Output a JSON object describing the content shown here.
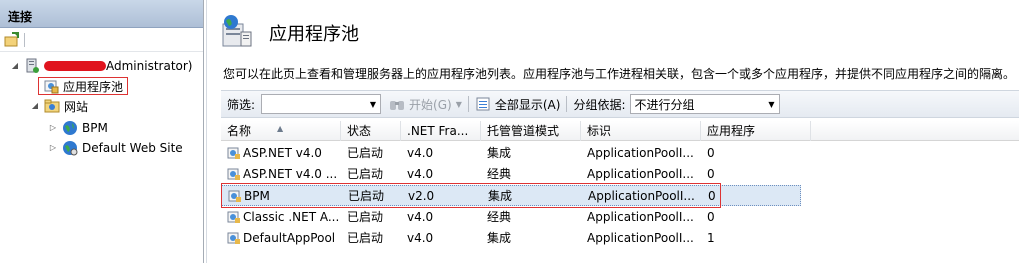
{
  "connections": {
    "title": "连接",
    "server_label_suffix": "Administrator)",
    "tree": {
      "app_pools": "应用程序池",
      "sites": "网站",
      "site_items": [
        "BPM",
        "Default Web Site"
      ]
    }
  },
  "page": {
    "title": "应用程序池",
    "description": "您可以在此页上查看和管理服务器上的应用程序池列表。应用程序池与工作进程相关联，包含一个或多个应用程序，并提供不同应用程序之间的隔离。"
  },
  "filterbar": {
    "filter_label": "筛选:",
    "start_label": "开始(G)",
    "show_all_label": "全部显示(A)",
    "group_label": "分组依据:",
    "group_value": "不进行分组"
  },
  "grid": {
    "headers": [
      "名称",
      "状态",
      ".NET Fra...",
      "托管管道模式",
      "标识",
      "应用程序"
    ],
    "rows": [
      {
        "name": "ASP.NET v4.0",
        "status": "已启动",
        "net": "v4.0",
        "pipeline": "集成",
        "identity": "ApplicationPoolI...",
        "apps": "0"
      },
      {
        "name": "ASP.NET v4.0 ...",
        "status": "已启动",
        "net": "v4.0",
        "pipeline": "经典",
        "identity": "ApplicationPoolI...",
        "apps": "0"
      },
      {
        "name": "BPM",
        "status": "已启动",
        "net": "v2.0",
        "pipeline": "集成",
        "identity": "ApplicationPoolI...",
        "apps": "0"
      },
      {
        "name": "Classic .NET A...",
        "status": "已启动",
        "net": "v4.0",
        "pipeline": "经典",
        "identity": "ApplicationPoolI...",
        "apps": "0"
      },
      {
        "name": "DefaultAppPool",
        "status": "已启动",
        "net": "v4.0",
        "pipeline": "集成",
        "identity": "ApplicationPoolI...",
        "apps": "1"
      }
    ]
  },
  "colors": {
    "highlight": "#dd3333",
    "selection": "#dce8f5"
  }
}
